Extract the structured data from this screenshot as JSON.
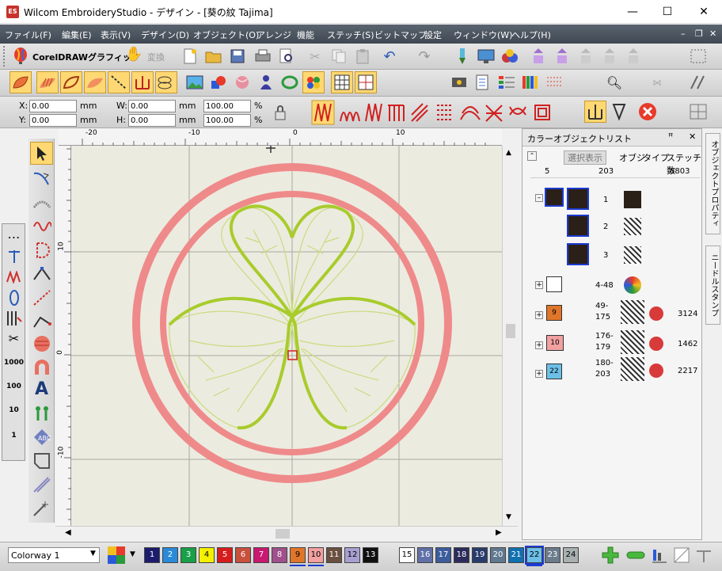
{
  "window": {
    "title": "Wilcom EmbroideryStudio - デザイン - [葵の紋      Tajima]",
    "app_icon": "ES",
    "minimize": "—",
    "maximize": "☐",
    "close": "✕"
  },
  "menu": [
    "ファイル(F)",
    "編集(E)",
    "表示(V)",
    "デザイン(D)",
    "オブジェクト(O)",
    "アレンジ",
    "機能",
    "ステッチ(S)",
    "ビットマップ",
    "設定",
    "ウィンドウ(W)",
    "ヘルプ(H)"
  ],
  "toolbar": {
    "coreldraw_label": "CorelDRAWグラフィック",
    "convert_label": "変換"
  },
  "props": {
    "x_label": "X:",
    "y_label": "Y:",
    "w_label": "W:",
    "h_label": "H:",
    "x_value": "0.00",
    "y_value": "0.00",
    "w_value": "0.00",
    "h_value": "0.00",
    "unit": "mm",
    "pct_w": "100.00",
    "pct_h": "100.00",
    "pct_unit": "%"
  },
  "ruler": {
    "top_ticks": [
      "-20",
      "-10",
      "0",
      "10"
    ],
    "left_ticks": [
      "10",
      "0",
      "-10"
    ]
  },
  "panel": {
    "title": "カラーオブジェクトリスト",
    "pin": "ꟸ",
    "close": "✕",
    "select_display": "選択表示",
    "col_object": "オブジ",
    "col_type": "タイプ",
    "col_stitches": "ステッチ数",
    "summary": {
      "count": "5",
      "objects": "203",
      "stitches": "6803"
    },
    "rows": [
      {
        "label": "1",
        "kind": "object"
      },
      {
        "label": "2",
        "kind": "object"
      },
      {
        "label": "3",
        "kind": "object"
      },
      {
        "label": "4-48",
        "kind": "group"
      },
      {
        "color_no": "9",
        "color": "#e0762a",
        "range_a": "49-",
        "range_b": "175",
        "stitches": "3124"
      },
      {
        "color_no": "10",
        "color": "#f2a0a0",
        "range_a": "176-",
        "range_b": "179",
        "stitches": "1462"
      },
      {
        "color_no": "22",
        "color": "#6cc0e8",
        "range_a": "180-",
        "range_b": "203",
        "stitches": "2217"
      }
    ]
  },
  "side_tabs": {
    "tab1": "オブジェクトプロパティ",
    "tab2": "ニードルスタンプ"
  },
  "colorway": {
    "selected": "Colorway 1",
    "swatches": [
      {
        "n": "1",
        "c": "#1c1c6e"
      },
      {
        "n": "2",
        "c": "#2a8ad8"
      },
      {
        "n": "3",
        "c": "#18a048"
      },
      {
        "n": "4",
        "c": "#f4f000"
      },
      {
        "n": "5",
        "c": "#d81c1c"
      },
      {
        "n": "6",
        "c": "#c8503c"
      },
      {
        "n": "7",
        "c": "#c81870"
      },
      {
        "n": "8",
        "c": "#a0508c"
      },
      {
        "n": "9",
        "c": "#e0762a"
      },
      {
        "n": "10",
        "c": "#f2a0a0"
      },
      {
        "n": "11",
        "c": "#6a5040"
      },
      {
        "n": "12",
        "c": "#a8a0d0"
      },
      {
        "n": "13",
        "c": "#101010"
      },
      {
        "n": "15",
        "c": "#ffffff"
      },
      {
        "n": "16",
        "c": "#6070a8"
      },
      {
        "n": "17",
        "c": "#3c5c9c"
      },
      {
        "n": "18",
        "c": "#2c2c5c"
      },
      {
        "n": "19",
        "c": "#283c6c"
      },
      {
        "n": "20",
        "c": "#607890"
      },
      {
        "n": "21",
        "c": "#1070b0"
      },
      {
        "n": "22",
        "c": "#6cc0e8"
      },
      {
        "n": "23",
        "c": "#6c7c8c"
      },
      {
        "n": "24",
        "c": "#a8b0b0"
      }
    ]
  },
  "colors": {
    "accent_select": "#1b3bd1",
    "outer_ring": "#ef8a8a",
    "leaf_green": "#a8cc2c",
    "canvas_bg": "#ecebe0"
  },
  "left_tools_labels": [
    "1000",
    "100",
    "10",
    "1"
  ]
}
